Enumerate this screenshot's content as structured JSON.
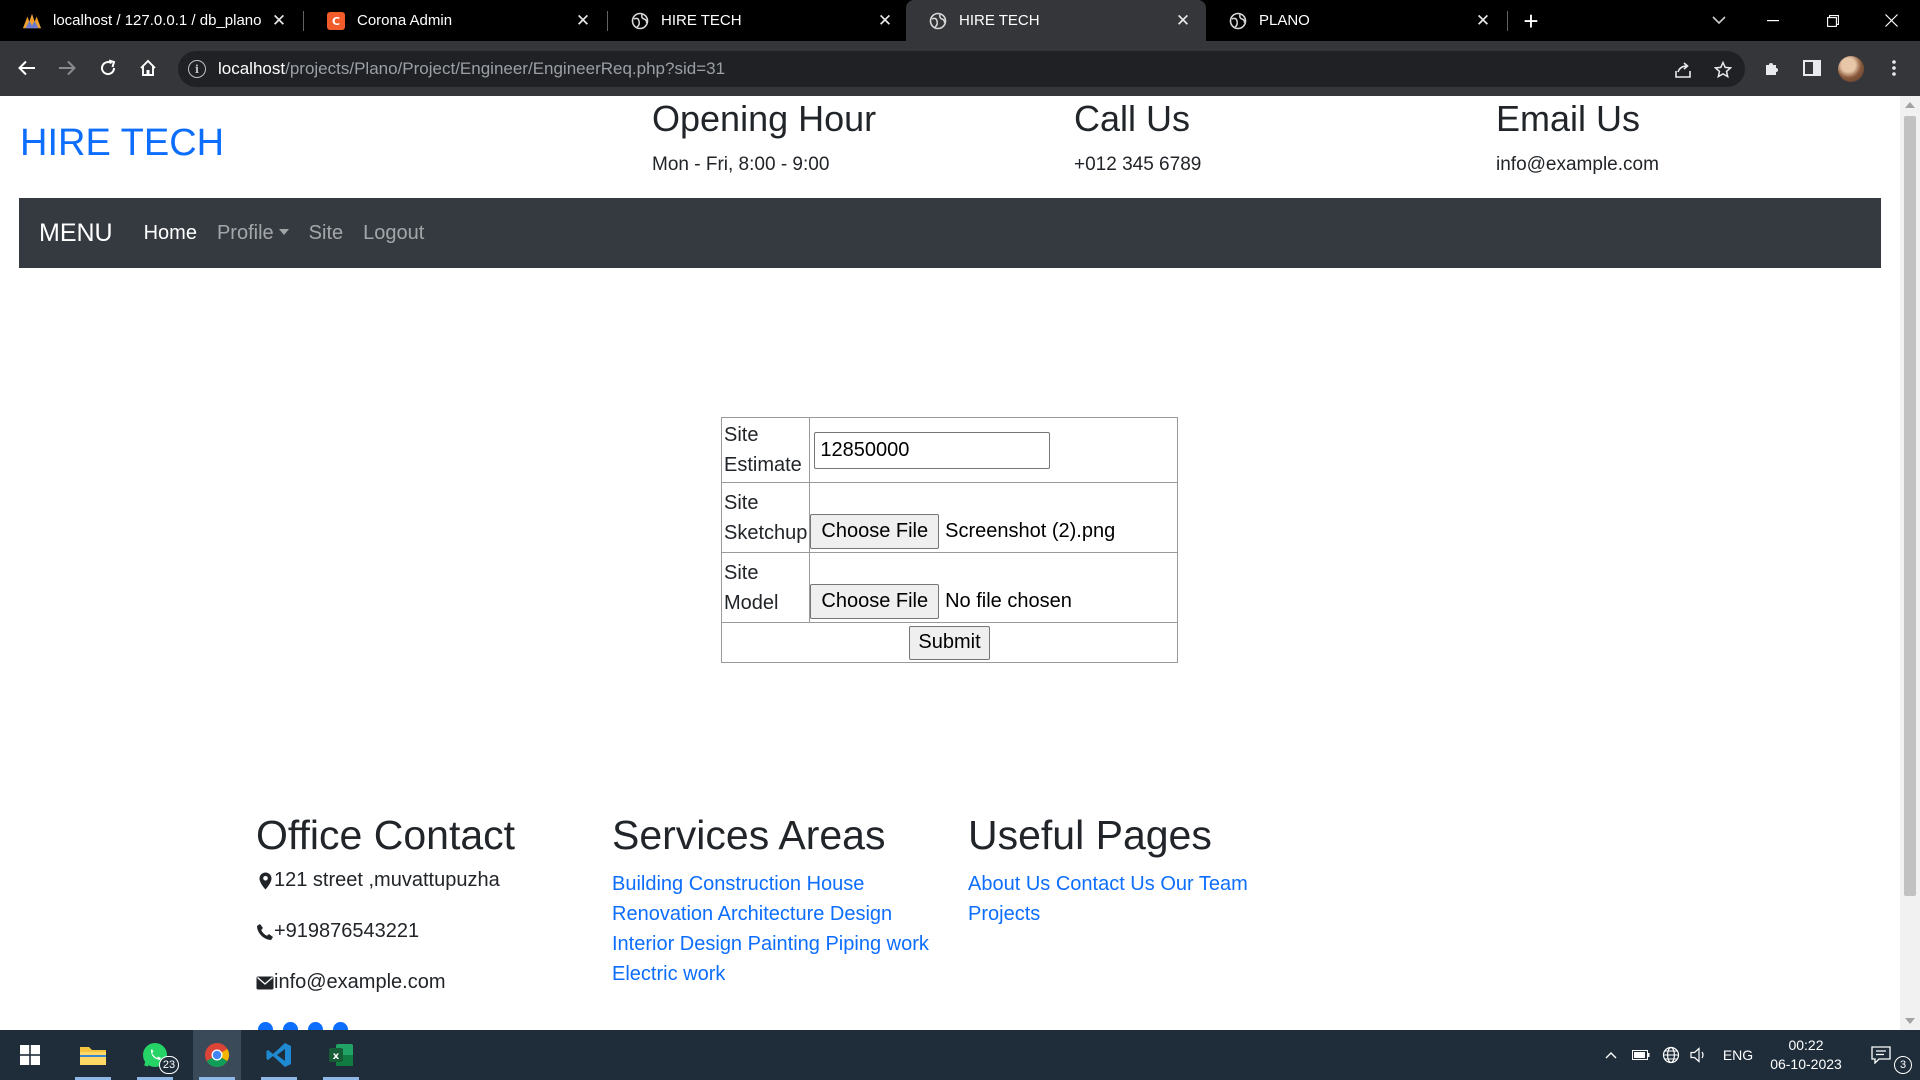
{
  "browser": {
    "tabs": [
      {
        "title": "localhost / 127.0.0.1 / db_plano",
        "icon": "phpmyadmin-icon",
        "active": false
      },
      {
        "title": "Corona Admin",
        "icon": "corona-admin-icon",
        "active": false
      },
      {
        "title": "HIRE TECH",
        "icon": "globe-icon",
        "active": false
      },
      {
        "title": "HIRE TECH",
        "icon": "globe-icon",
        "active": true
      },
      {
        "title": "PLANO",
        "icon": "globe-icon",
        "active": false
      }
    ],
    "url_host": "localhost",
    "url_path": "/projects/Plano/Project/Engineer/EngineerReq.php?sid=31"
  },
  "site": {
    "brand": "HIRE TECH",
    "opening": {
      "title": "Opening Hour",
      "text": "Mon - Fri, 8:00 - 9:00"
    },
    "call": {
      "title": "Call Us",
      "text": "+012 345 6789"
    },
    "email": {
      "title": "Email Us",
      "text": "info@example.com"
    },
    "menu": {
      "title": "MENU",
      "items": [
        "Home",
        "Profile",
        "Site",
        "Logout"
      ]
    }
  },
  "form": {
    "estimate_label_1": "Site",
    "estimate_label_2": "Estimate",
    "estimate_value": "12850000",
    "sketchup_label_1": "Site",
    "sketchup_label_2": "Sketchup",
    "sketchup_button": "Choose File",
    "sketchup_file": "Screenshot (2).png",
    "model_label_1": "Site",
    "model_label_2": "Model",
    "model_button": "Choose File",
    "model_file": "No file chosen",
    "submit": "Submit"
  },
  "footer": {
    "office": {
      "title": "Office Contact",
      "address": "121 street ,muvattupuzha",
      "phone": "+919876543221",
      "email": "info@example.com"
    },
    "services": {
      "title": "Services Areas",
      "links": [
        "Building Construction",
        "House",
        "Renovation",
        "Architecture Design",
        "Interior Design",
        "Painting",
        "Piping work",
        "Electric work"
      ]
    },
    "pages": {
      "title": "Useful Pages",
      "links": [
        "About Us",
        "Contact Us",
        "Our Team",
        "Projects"
      ]
    }
  },
  "taskbar": {
    "whatsapp_badge": "23",
    "language": "ENG",
    "time": "00:22",
    "date": "06-10-2023",
    "notifications": "3"
  },
  "colors": {
    "link": "#0d6efd",
    "navbar": "#343a40",
    "tabbar": "#000000",
    "toolbar": "#35363a",
    "taskbar": "#1f2d3a"
  }
}
